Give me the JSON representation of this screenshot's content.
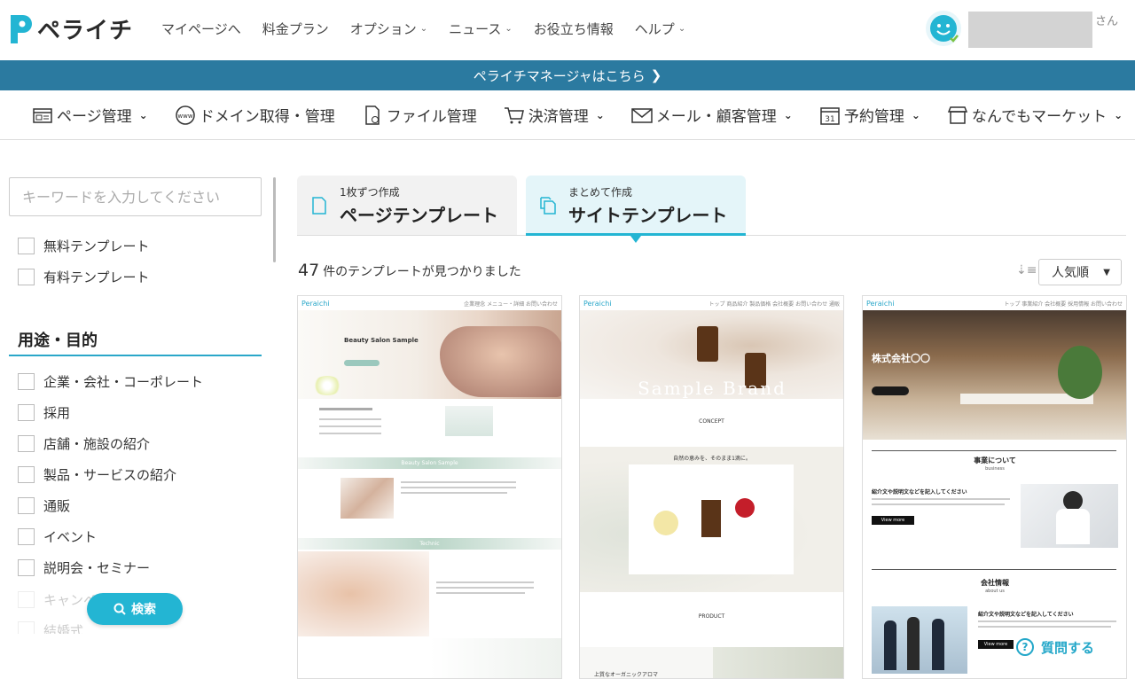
{
  "header": {
    "logo_text": "ペライチ",
    "nav": [
      {
        "label": "マイページへ",
        "has_dropdown": false
      },
      {
        "label": "料金プラン",
        "has_dropdown": false
      },
      {
        "label": "オプション",
        "has_dropdown": true
      },
      {
        "label": "ニュース",
        "has_dropdown": true
      },
      {
        "label": "お役立ち情報",
        "has_dropdown": false
      },
      {
        "label": "ヘルプ",
        "has_dropdown": true
      }
    ],
    "user_suffix": "さん"
  },
  "banner": {
    "label": "ペライチマネージャはこちら"
  },
  "subnav": [
    {
      "label": "ページ管理",
      "icon": "browser-icon",
      "has_dropdown": true
    },
    {
      "label": "ドメイン取得・管理",
      "icon": "www-globe-icon",
      "has_dropdown": false
    },
    {
      "label": "ファイル管理",
      "icon": "file-icon",
      "has_dropdown": false
    },
    {
      "label": "決済管理",
      "icon": "cart-icon",
      "has_dropdown": true
    },
    {
      "label": "メール・顧客管理",
      "icon": "mail-icon",
      "has_dropdown": true
    },
    {
      "label": "予約管理",
      "icon": "calendar-icon",
      "has_dropdown": true
    },
    {
      "label": "なんでもマーケット",
      "icon": "shop-icon",
      "has_dropdown": true
    }
  ],
  "sidebar": {
    "search_placeholder": "キーワードを入力してください",
    "price_filters": [
      "無料テンプレート",
      "有料テンプレート"
    ],
    "purpose_title": "用途・目的",
    "purpose_filters": [
      "企業・会社・コーポレート",
      "採用",
      "店舗・施設の紹介",
      "製品・サービスの紹介",
      "通販",
      "イベント",
      "説明会・セミナー",
      "キャンペーン",
      "結婚式"
    ],
    "search_button": "検索"
  },
  "tabs": [
    {
      "small": "1枚ずつ作成",
      "big": "ページテンプレート",
      "active": false
    },
    {
      "small": "まとめて作成",
      "big": "サイトテンプレート",
      "active": true
    }
  ],
  "results": {
    "count": "47",
    "suffix": "件のテンプレートが見つかりました"
  },
  "sort": {
    "selected": "人気順"
  },
  "cards": [
    {
      "brand": "Peraichi",
      "nav": "企業理念  メニュー・詳細  お問い合わせ",
      "hero_title": "Beauty Salon Sample",
      "section1": "Beauty Salon Sample",
      "section2": "Technic"
    },
    {
      "brand": "Peraichi",
      "nav": "トップ  商品紹介  製品価格  会社概要  お問い合わせ  通販",
      "hero_title": "Sample Brand",
      "section1": "CONCEPT",
      "section2": "PRODUCT",
      "caption": "自然の恵みを、そのまま1滴に。",
      "footer_text": "上質なオーガニックアロマ"
    },
    {
      "brand": "Peraichi",
      "nav": "トップ  事業紹介  会社概要  採用情報  お問い合わせ",
      "hero_title": "株式会社〇〇",
      "section1": "事業について",
      "section1_sub": "business",
      "section2": "会社情報",
      "section2_sub": "about us",
      "button": "View more",
      "heading": "紹介文や説明文などを記入してください"
    }
  ],
  "help": {
    "label": "質問する"
  },
  "colors": {
    "accent": "#23b5d3",
    "banner": "#2b7aa0"
  }
}
